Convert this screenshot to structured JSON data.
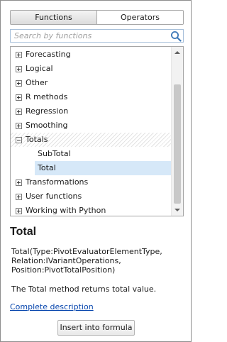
{
  "tabs": {
    "functions": "Functions",
    "operators": "Operators"
  },
  "search": {
    "placeholder": "Search by functions",
    "value": ""
  },
  "tree": [
    {
      "label": "Forecasting",
      "expander": "plus"
    },
    {
      "label": "Logical",
      "expander": "plus"
    },
    {
      "label": "Other",
      "expander": "plus"
    },
    {
      "label": "R methods",
      "expander": "plus"
    },
    {
      "label": "Regression",
      "expander": "plus"
    },
    {
      "label": "Smoothing",
      "expander": "plus"
    },
    {
      "label": "Totals",
      "expander": "minus"
    },
    {
      "label": "SubTotal"
    },
    {
      "label": "Total",
      "selected": true
    },
    {
      "label": "Transformations",
      "expander": "plus"
    },
    {
      "label": "User functions",
      "expander": "plus"
    },
    {
      "label": "Working with Python",
      "expander": "plus"
    }
  ],
  "details": {
    "title": "Total",
    "signature": [
      "Total(Type:PivotEvaluatorElementType,",
      "Relation:IVariantOperations,",
      "Position:PivotTotalPosition)"
    ],
    "description": "The Total method returns total value.",
    "link": "Complete description",
    "insert_button": "Insert into formula"
  },
  "icons": {
    "search": "search-icon",
    "scroll_up": "arrow-up-icon",
    "scroll_down": "arrow-down-icon",
    "expand": "plus-icon",
    "collapse": "minus-icon"
  },
  "colors": {
    "selection": "#d6e8f8",
    "link": "#0645ad",
    "search_border": "#a8c0da",
    "search_icon": "#3d78b8"
  }
}
